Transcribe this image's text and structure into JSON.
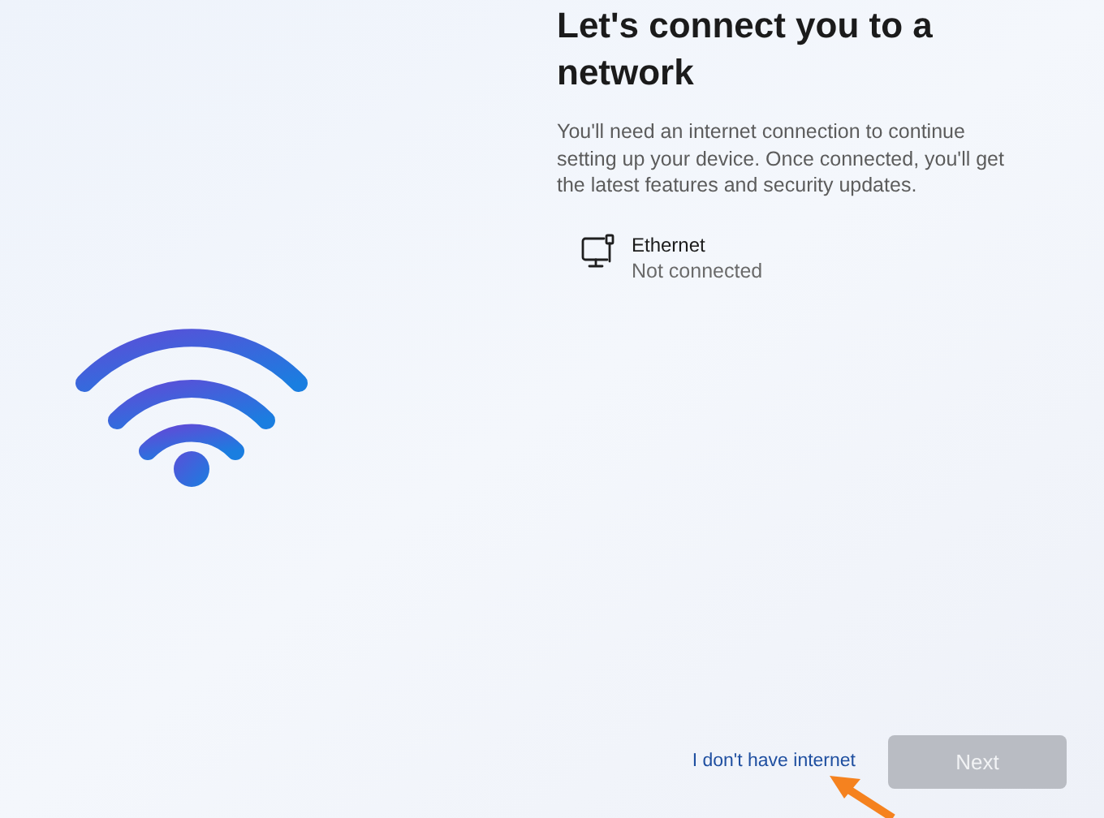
{
  "heading": "Let's connect you to a network",
  "description": "You'll need an internet connection to continue setting up your device. Once connected, you'll get the latest features and security updates.",
  "networks": [
    {
      "name": "Ethernet",
      "status": "Not connected",
      "kind": "wired"
    }
  ],
  "link": "I don't have internet",
  "next_button": {
    "label": "Next",
    "disabled": true
  }
}
